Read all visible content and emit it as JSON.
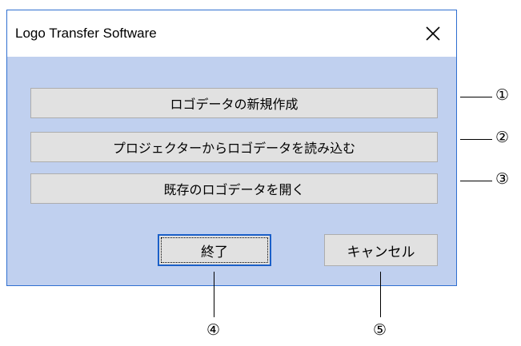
{
  "window": {
    "title": "Logo Transfer Software"
  },
  "buttons": {
    "new_logo": "ロゴデータの新規作成",
    "load_from_projector": "プロジェクターからロゴデータを読み込む",
    "open_existing": "既存のロゴデータを開く",
    "exit": "終了",
    "cancel": "キャンセル"
  },
  "callouts": {
    "c1": "①",
    "c2": "②",
    "c3": "③",
    "c4": "④",
    "c5": "⑤"
  },
  "colors": {
    "client_background": "#c0d0ef",
    "button_face": "#e1e1e1",
    "focus_border": "#1a5fc8"
  }
}
